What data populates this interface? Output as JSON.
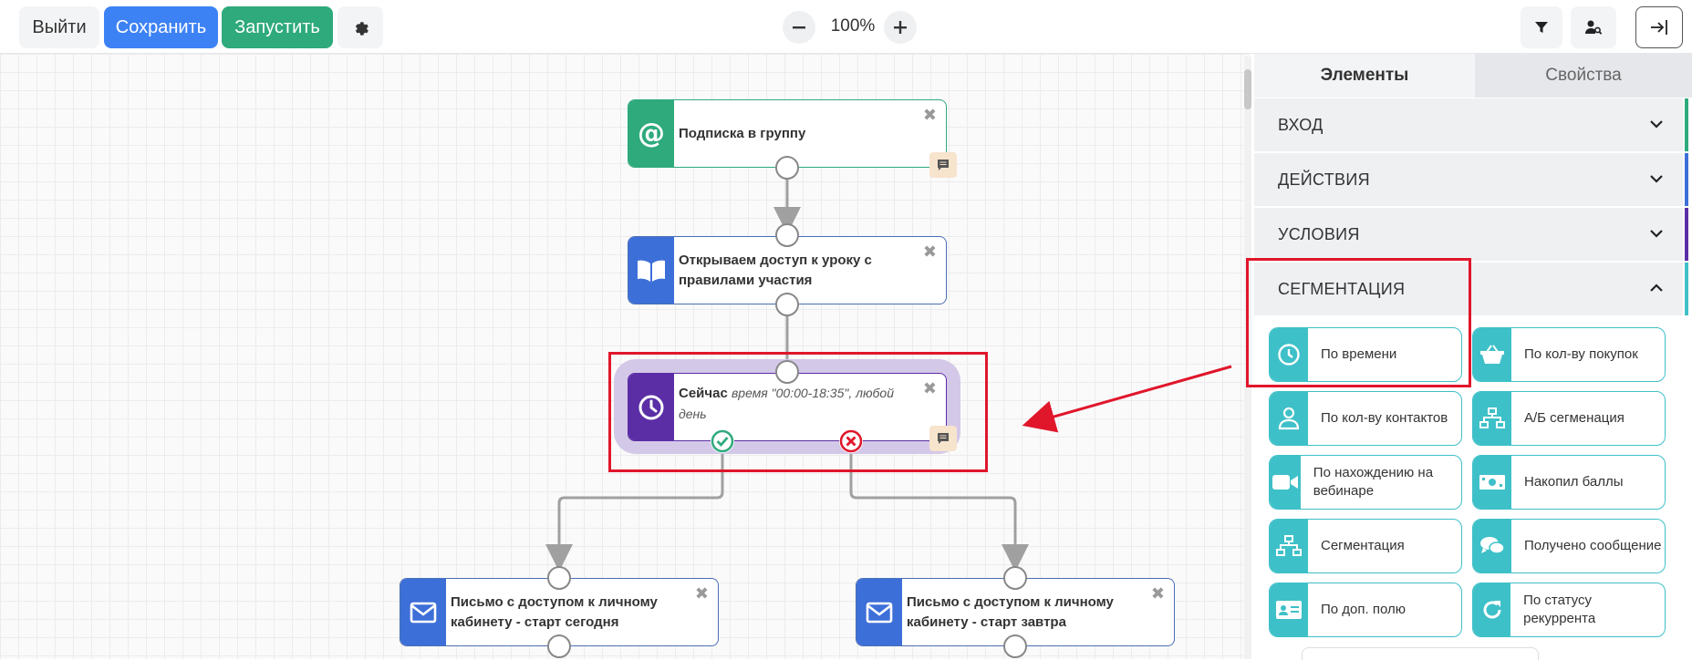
{
  "toolbar": {
    "exit_label": "Выйти",
    "save_label": "Сохранить",
    "run_label": "Запустить",
    "zoom_value": "100%",
    "icons": [
      "gear-icon",
      "minus-icon",
      "plus-icon",
      "filter-icon",
      "user-search-icon",
      "collapse-panel-icon"
    ]
  },
  "canvas": {
    "nodes": [
      {
        "title": "Подписка в группу",
        "icon": "at-icon",
        "color": "#2eaa7c"
      },
      {
        "title": "Открываем доступ к уроку с правилами участия",
        "icon": "book-icon",
        "color": "#3d6fd8"
      },
      {
        "title": "Сейчас",
        "subtitle": "время \"00:00-18:35\", любой день",
        "icon": "clock-icon",
        "color": "#5b2ea6"
      },
      {
        "title": "Письмо с доступом к личному кабинету - старт сегодня",
        "icon": "envelope-icon",
        "color": "#3d6fd8"
      },
      {
        "title": "Письмо с доступом к личному кабинету - старт завтра",
        "icon": "envelope-icon",
        "color": "#3d6fd8"
      }
    ],
    "connector_color": "#a0a0a0"
  },
  "panel": {
    "tabs": [
      "Элементы",
      "Свойства"
    ],
    "sections": [
      {
        "label": "ВХОД",
        "color": "#2eaa7c"
      },
      {
        "label": "ДЕЙСТВИЯ",
        "color": "#3d6fd8"
      },
      {
        "label": "УСЛОВИЯ",
        "color": "#5b2ea6"
      },
      {
        "label": "СЕГМЕНТАЦИЯ",
        "color": "#3ec0c8"
      }
    ],
    "tiles": [
      {
        "label": "По времени",
        "icon": "clock-icon"
      },
      {
        "label": "По кол-ву покупок",
        "icon": "basket-icon"
      },
      {
        "label": "По кол-ву контактов",
        "icon": "person-icon"
      },
      {
        "label": "А/Б сегменация",
        "icon": "sitemap-icon"
      },
      {
        "label": "По нахождению на вебинаре",
        "icon": "video-icon"
      },
      {
        "label": "Накопил баллы",
        "icon": "money-icon"
      },
      {
        "label": "Сегментация",
        "icon": "sitemap-icon"
      },
      {
        "label": "Получено сообщение",
        "icon": "chat-icon"
      },
      {
        "label": "По доп. полю",
        "icon": "id-card-icon"
      },
      {
        "label": "По статусу рекуррента",
        "icon": "refresh-icon"
      }
    ]
  },
  "annotation_color": "#e0162b"
}
